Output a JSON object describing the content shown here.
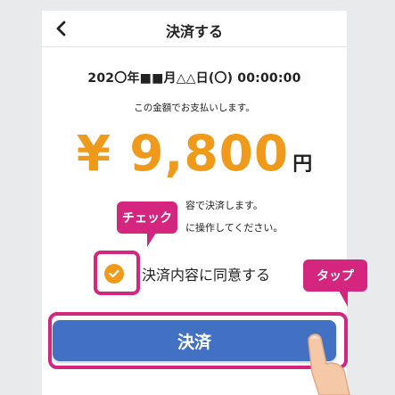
{
  "header": {
    "title": "決済する",
    "back_icon": "chevron-left-icon"
  },
  "payment": {
    "datetime": "202〇年■■月△△日(〇) 00:00:00",
    "notice": "この金額でお支払いします。",
    "amount": "¥ 9,800",
    "currency_unit": "円",
    "partial_line_1": "容で決済します。",
    "partial_line_2": "に操作してください。"
  },
  "agreement": {
    "label": "決済内容に同意する",
    "checked": true,
    "check_icon": "checkmark-icon"
  },
  "pay_button": {
    "label": "決済"
  },
  "annotations": {
    "check_callout": "チェック",
    "tap_callout": "タップ",
    "highlight_color": "#d4257f"
  },
  "colors": {
    "amount": "#ef9a1a",
    "button": "#4271c4",
    "checkbox": "#ef9a1a"
  }
}
